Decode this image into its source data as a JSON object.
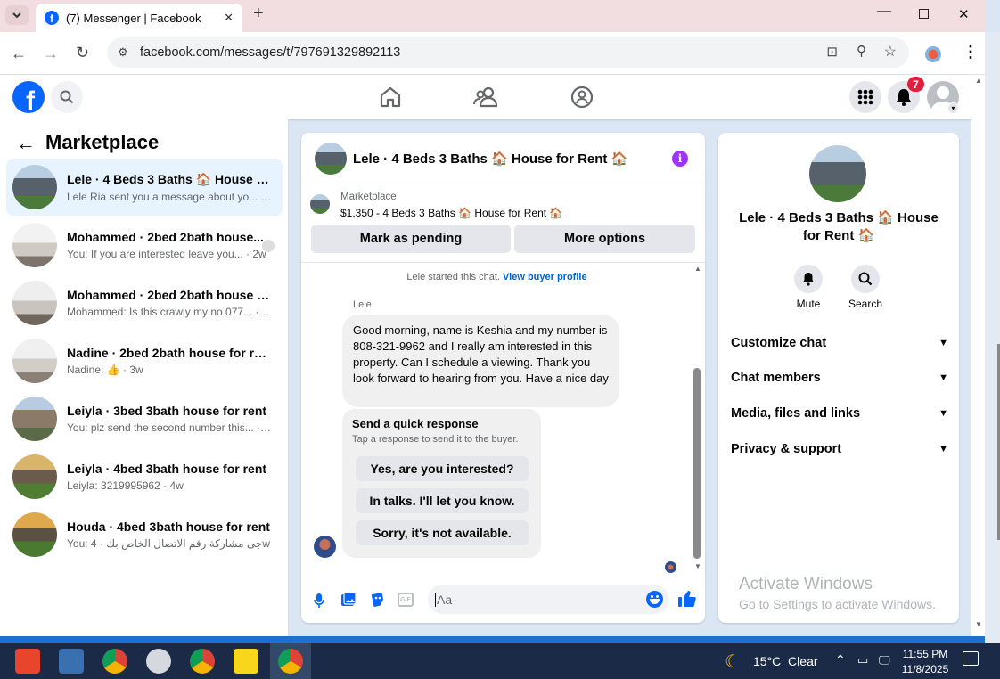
{
  "browser": {
    "tab_title": "(7) Messenger | Facebook",
    "url": "facebook.com/messages/t/797691329892113"
  },
  "header": {
    "notification_count": "7"
  },
  "left": {
    "title": "Marketplace",
    "conversations": [
      {
        "title": "Lele · 4 Beds 3 Baths 🏠 House for ...",
        "preview": "Lele Ria sent you a message about yo...",
        "time": "3m"
      },
      {
        "title": "Mohammed · 2bed 2bath house...",
        "preview": "You: If you are interested leave you...",
        "time": "2w"
      },
      {
        "title": "Mohammed · 2bed 2bath house fo...",
        "preview": "Mohammed: Is this crawly my no 077...",
        "time": "3w"
      },
      {
        "title": "Nadine · 2bed 2bath house for rent",
        "preview": "Nadine: 👍",
        "time": "3w"
      },
      {
        "title": "Leiyla · 3bed 3bath house for rent",
        "preview": "You: plz send the second number this...",
        "time": "4w"
      },
      {
        "title": "Leiyla · 4bed 3bath house for rent",
        "preview": "Leiyla: 3219995962",
        "time": "4w"
      },
      {
        "title": "Houda · 4bed 3bath house for rent",
        "preview": "You: جى مشاركة رقم الاتصال الخاص بك",
        "time": "4w"
      }
    ]
  },
  "chat": {
    "title": "Lele · 4 Beds 3 Baths 🏠 House for Rent 🏠",
    "listing_source": "Marketplace",
    "listing_desc": "$1,350 - 4 Beds 3 Baths 🏠 House for Rent 🏠",
    "mark_pending": "Mark as pending",
    "more_options": "More options",
    "started_text": "Lele started this chat.",
    "view_profile": "View buyer profile",
    "sender_name": "Lele",
    "message": "Good morning, name is Keshia and my number is 808-321-9962 and I really am interested in this property. Can I schedule a viewing. Thank you look forward to hearing from you. Have a nice day",
    "quick_title": "Send a quick response",
    "quick_sub": "Tap a response to send it to the buyer.",
    "quick_responses": [
      "Yes, are you interested?",
      "In talks. I'll let you know.",
      "Sorry, it's not available."
    ],
    "input_placeholder": "Aa"
  },
  "right": {
    "title": "Lele · 4 Beds 3 Baths 🏠 House for Rent 🏠",
    "mute": "Mute",
    "search": "Search",
    "sections": [
      "Customize chat",
      "Chat members",
      "Media, files and links",
      "Privacy & support"
    ],
    "watermark_title": "Activate Windows",
    "watermark_sub": "Go to Settings to activate Windows."
  },
  "taskbar": {
    "weather": "15°C  Clear",
    "time": "11:55 PM",
    "date": "11/8/2025"
  },
  "colors": {
    "fb_blue": "#0866ff",
    "purple": "#a033ff",
    "link": "#0064d1"
  }
}
